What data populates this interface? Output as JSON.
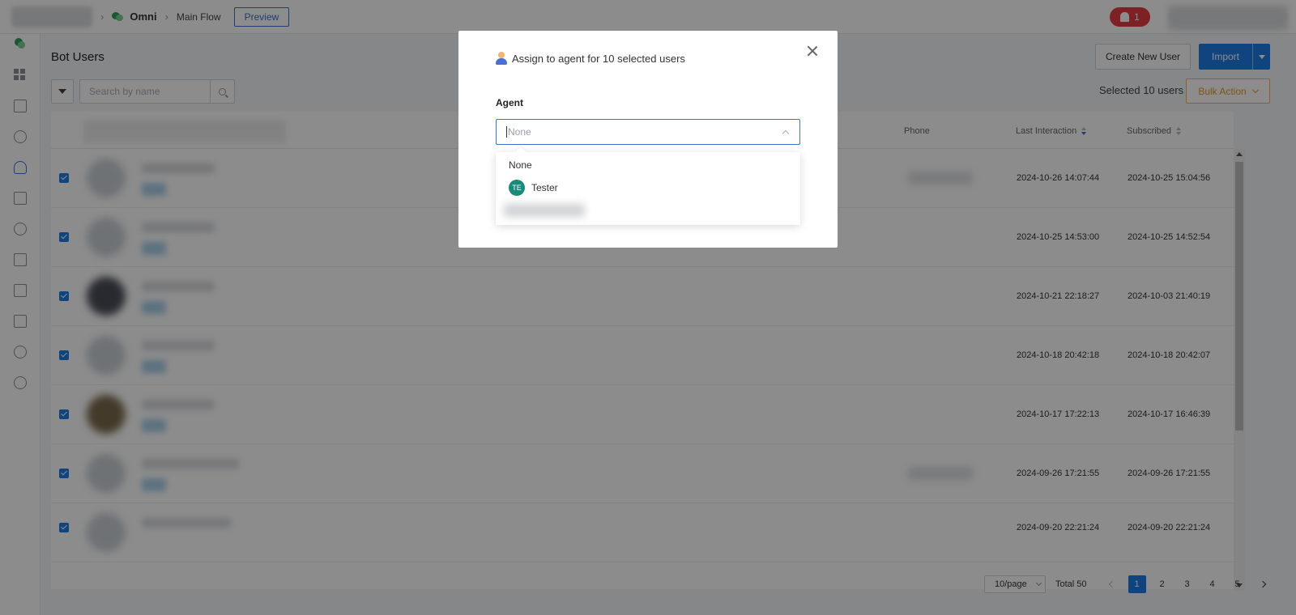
{
  "topbar": {
    "bot_name": "Omni",
    "flow_name": "Main Flow",
    "preview_label": "Preview",
    "notification_count": "1"
  },
  "page": {
    "title": "Bot Users",
    "create_label": "Create New User",
    "import_label": "Import",
    "search_placeholder": "Search by name",
    "selected_text": "Selected 10 users",
    "bulk_action_label": "Bulk Action"
  },
  "table": {
    "headers": {
      "phone": "Phone",
      "last_interaction": "Last Interaction",
      "subscribed": "Subscribed"
    },
    "rows": [
      {
        "last": "2024-10-26 14:07:44",
        "subscribed": "2024-10-25 15:04:56"
      },
      {
        "last": "2024-10-25 14:53:00",
        "subscribed": "2024-10-25 14:52:54"
      },
      {
        "last": "2024-10-21 22:18:27",
        "subscribed": "2024-10-03 21:40:19"
      },
      {
        "last": "2024-10-18 20:42:18",
        "subscribed": "2024-10-18 20:42:07"
      },
      {
        "last": "2024-10-17 17:22:13",
        "subscribed": "2024-10-17 16:46:39"
      },
      {
        "last": "2024-09-26 17:21:55",
        "subscribed": "2024-09-26 17:21:55"
      },
      {
        "last": "2024-09-20 22:21:24",
        "subscribed": "2024-09-20 22:21:24"
      }
    ]
  },
  "pagination": {
    "page_size": "10/page",
    "total": "Total 50",
    "pages": [
      "1",
      "2",
      "3",
      "4",
      "5"
    ],
    "current": "1"
  },
  "modal": {
    "title": "Assign to agent for 10 selected users",
    "agent_label": "Agent",
    "agent_value": "None",
    "options": [
      {
        "label": "None"
      },
      {
        "label": "Tester",
        "initials": "TE"
      }
    ]
  },
  "colors": {
    "primary": "#1c7ce8",
    "notification": "#e43d44",
    "bulk_action": "#e89a21",
    "agent_avatar": "#178c7a"
  }
}
